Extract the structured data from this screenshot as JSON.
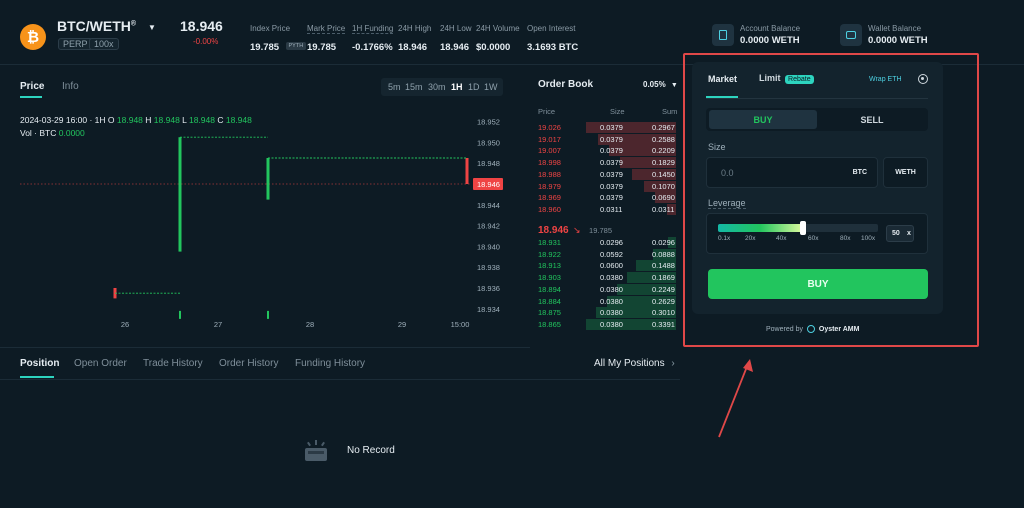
{
  "header": {
    "pair_base": "BTC",
    "pair_quote": "/WETH",
    "pair_mark": "®",
    "perp_tag": "PERP",
    "leverage_tag": "100x",
    "price": "18.946",
    "change": "-0.00%",
    "stats": [
      {
        "label": "Index Price",
        "value": "19.785",
        "badge": "PYTH"
      },
      {
        "label": "Mark Price",
        "value": "19.785"
      },
      {
        "label": "1H Funding",
        "value": "-0.1766%"
      },
      {
        "label": "24H High",
        "value": "18.946"
      },
      {
        "label": "24H Low",
        "value": "18.946"
      },
      {
        "label": "24H Volume",
        "value": "$0.0000"
      },
      {
        "label": "Open Interest",
        "value": "3.1693 BTC"
      }
    ],
    "account_balance_label": "Account Balance",
    "account_balance_value": "0.0000 WETH",
    "wallet_balance_label": "Wallet Balance",
    "wallet_balance_value": "0.0000 WETH"
  },
  "chart": {
    "tab_price": "Price",
    "tab_info": "Info",
    "intervals": [
      "5m",
      "15m",
      "30m",
      "1H",
      "1D",
      "1W"
    ],
    "active_interval": "1H",
    "ohlc_prefix": "2024-03-29 16:00 · 1H",
    "o_label": "O",
    "o_value": "18.948",
    "h_label": "H",
    "h_value": "18.948",
    "l_label": "L",
    "l_value": "18.948",
    "c_label": "C",
    "c_value": "18.948",
    "vol_label": "Vol · BTC",
    "vol_value": "0.0000",
    "y_ticks": [
      "18.952",
      "18.950",
      "18.948",
      "18.946",
      "18.944",
      "18.942",
      "18.940",
      "18.938",
      "18.936",
      "18.934"
    ],
    "current_price_tag": "18.946",
    "x_ticks": [
      "26",
      "27",
      "28",
      "29",
      "15:00"
    ]
  },
  "chart_data": {
    "type": "candlestick",
    "x_labels": [
      "26",
      "27",
      "28",
      "29",
      "15:00"
    ],
    "ylim": [
      18.933,
      18.953
    ],
    "current_price": 18.946,
    "candles": [
      {
        "x": "26",
        "open": 18.935,
        "high": 18.936,
        "low": 18.935,
        "close": 18.935,
        "color": "red"
      },
      {
        "x": "26.7",
        "open": 18.9395,
        "high": 18.9505,
        "low": 18.9395,
        "close": 18.9505,
        "color": "green"
      },
      {
        "x": "27.6",
        "open": 18.9445,
        "high": 18.9485,
        "low": 18.9445,
        "close": 18.9485,
        "color": "green"
      },
      {
        "x": "15:00",
        "open": 18.9485,
        "high": 18.9485,
        "low": 18.946,
        "close": 18.946,
        "color": "red"
      }
    ]
  },
  "orderbook": {
    "title": "Order Book",
    "precision": "0.05%",
    "col_price": "Price",
    "col_size": "Size",
    "col_sum": "Sum",
    "asks": [
      {
        "price": "19.026",
        "size": "0.0379",
        "sum": "0.2967",
        "depth": 1.0
      },
      {
        "price": "19.017",
        "size": "0.0379",
        "sum": "0.2588",
        "depth": 0.87
      },
      {
        "price": "19.007",
        "size": "0.0379",
        "sum": "0.2209",
        "depth": 0.74
      },
      {
        "price": "18.998",
        "size": "0.0379",
        "sum": "0.1829",
        "depth": 0.62
      },
      {
        "price": "18.988",
        "size": "0.0379",
        "sum": "0.1450",
        "depth": 0.49
      },
      {
        "price": "18.979",
        "size": "0.0379",
        "sum": "0.1070",
        "depth": 0.36
      },
      {
        "price": "18.969",
        "size": "0.0379",
        "sum": "0.0690",
        "depth": 0.23
      },
      {
        "price": "18.960",
        "size": "0.0311",
        "sum": "0.0311",
        "depth": 0.1
      }
    ],
    "mid_price": "18.946",
    "mid_arrow": "↘",
    "mid_mark": "19.785",
    "bids": [
      {
        "price": "18.931",
        "size": "0.0296",
        "sum": "0.0296",
        "depth": 0.09
      },
      {
        "price": "18.922",
        "size": "0.0592",
        "sum": "0.0888",
        "depth": 0.26
      },
      {
        "price": "18.913",
        "size": "0.0600",
        "sum": "0.1488",
        "depth": 0.44
      },
      {
        "price": "18.903",
        "size": "0.0380",
        "sum": "0.1869",
        "depth": 0.55
      },
      {
        "price": "18.894",
        "size": "0.0380",
        "sum": "0.2249",
        "depth": 0.66
      },
      {
        "price": "18.884",
        "size": "0.0380",
        "sum": "0.2629",
        "depth": 0.77
      },
      {
        "price": "18.875",
        "size": "0.0380",
        "sum": "0.3010",
        "depth": 0.89
      },
      {
        "price": "18.865",
        "size": "0.0380",
        "sum": "0.3391",
        "depth": 1.0
      }
    ]
  },
  "trade": {
    "tab_market": "Market",
    "tab_limit": "Limit",
    "rebate_badge": "Rebate",
    "wrap_eth": "Wrap ETH",
    "buy_tab": "BUY",
    "sell_tab": "SELL",
    "size_label": "Size",
    "size_placeholder": "0.0",
    "size_unit_btc": "BTC",
    "size_unit_weth": "WETH",
    "leverage_label": "Leverage",
    "leverage_ticks": [
      "0.1x",
      "20x",
      "40x",
      "60x",
      "80x",
      "100x"
    ],
    "leverage_value": "50",
    "leverage_fraction": 0.5,
    "leverage_suffix": "x",
    "buy_button": "BUY",
    "powered_by": "Powered by",
    "powered_brand": "Oyster AMM"
  },
  "positions": {
    "tabs": [
      "Position",
      "Open Order",
      "Trade History",
      "Order History",
      "Funding History"
    ],
    "all_positions": "All My Positions",
    "empty": "No Record"
  },
  "colors": {
    "background": "#0d1b24",
    "green": "#22c55e",
    "red": "#ef4444",
    "annotation": "#e04848",
    "accent_teal": "#2dd4bf"
  }
}
